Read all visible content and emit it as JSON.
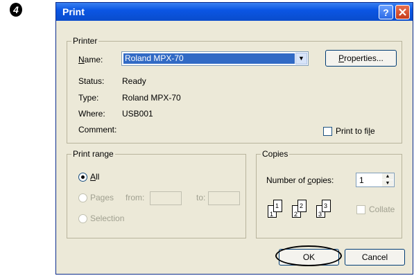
{
  "step": {
    "number": "4"
  },
  "window": {
    "title": "Print"
  },
  "printer": {
    "legend": "Printer",
    "name_label": "Name:",
    "name_value": "Roland MPX-70",
    "properties_button": "Properties...",
    "status_label": "Status:",
    "status_value": "Ready",
    "type_label": "Type:",
    "type_value": "Roland MPX-70",
    "where_label": "Where:",
    "where_value": "USB001",
    "comment_label": "Comment:",
    "print_to_file": "Print to file"
  },
  "print_range": {
    "legend": "Print range",
    "all": "All",
    "pages": "Pages",
    "from": "from:",
    "to": "to:",
    "selection": "Selection",
    "selected": "All"
  },
  "copies": {
    "legend": "Copies",
    "number_label": "Number of copies:",
    "number_value": "1",
    "collate": "Collate",
    "page_labels": [
      "1",
      "1",
      "2",
      "2",
      "3",
      "3"
    ]
  },
  "buttons": {
    "ok": "OK",
    "cancel": "Cancel"
  }
}
